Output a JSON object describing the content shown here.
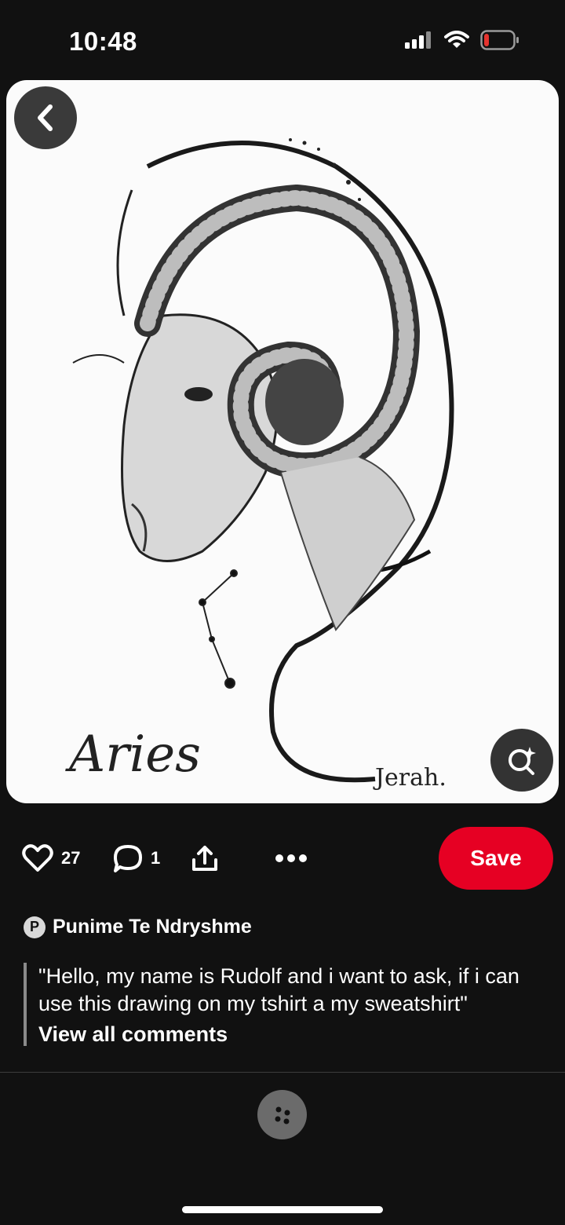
{
  "status_bar": {
    "time": "10:48",
    "battery_color": "#e5342f"
  },
  "pin": {
    "image_caption": "Aries",
    "image_signature": "Jerah."
  },
  "icons": {
    "back": "chevron-left-icon",
    "visual_search": "lens-sparkle-icon",
    "like": "heart-outline-icon",
    "comment": "speech-bubble-icon",
    "share": "share-upload-icon",
    "more": "ellipsis-icon",
    "related": "dots-cluster-icon"
  },
  "actions": {
    "likes_count": "27",
    "comments_count": "1",
    "save_label": "Save",
    "save_color": "#e60023"
  },
  "author": {
    "avatar_letter": "P",
    "name": "Punime Te Ndryshme"
  },
  "comment": {
    "text": "\"Hello, my name is Rudolf and i want to ask, if i can use this drawing on my tshirt a my sweatshirt\"",
    "view_all_label": "View all comments"
  }
}
